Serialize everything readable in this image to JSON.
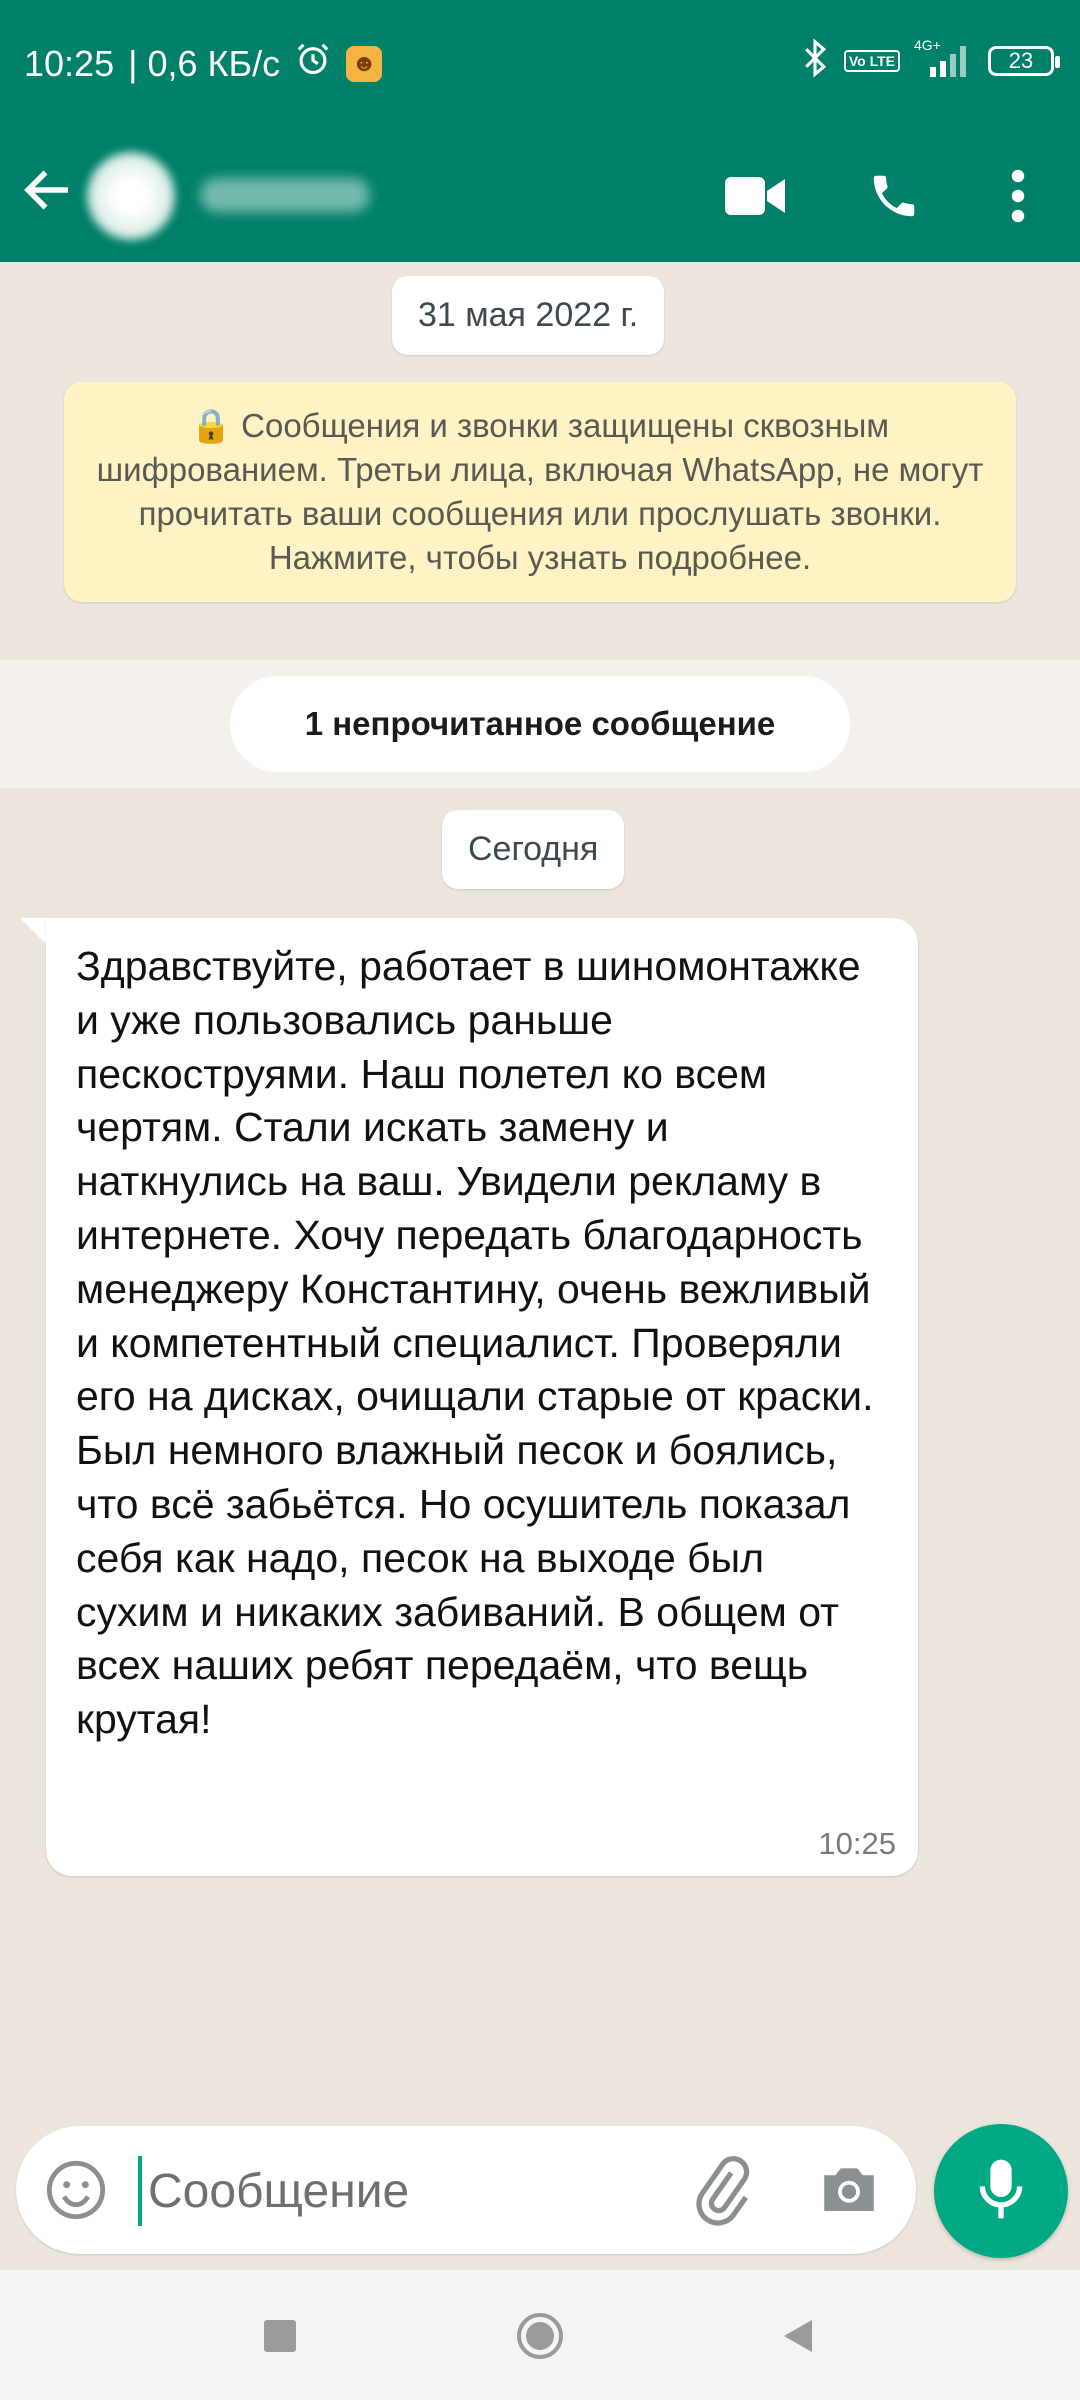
{
  "status_bar": {
    "time": "10:25",
    "speed": "| 0,6 КБ/с",
    "network": "4G+",
    "volte": "Vo LTE",
    "battery": "23",
    "icons": [
      "alarm-icon",
      "app-notification-icon",
      "bluetooth-icon",
      "volte-icon",
      "signal-icon",
      "battery-icon"
    ]
  },
  "app_bar": {
    "icons": [
      "back-arrow-icon",
      "video-call-icon",
      "phone-call-icon",
      "more-vert-icon"
    ]
  },
  "chat": {
    "date_chip": "31 мая 2022 г.",
    "encryption_notice": "🔒 Сообщения и звонки защищены сквозным шифрованием. Третьи лица, включая WhatsApp, не могут прочитать ваши сообщения или прослушать звонки. Нажмите, чтобы узнать подробнее.",
    "unread_label": "1 непрочитанное сообщение",
    "today_chip": "Сегодня",
    "message": {
      "text": "Здравствуйте, работает в шиномонтажке и уже пользовались раньше пескоструями. Наш полетел ко всем чертям. Стали искать замену и наткнулись на ваш. Увидели рекламу в интернете. Хочу передать благодарность менеджеру Константину, очень вежливый и компетентный специалист. Проверяли его на дисках, очищали старые от краски. Был немного влажный песок и боялись, что всё забьётся. Но осушитель показал себя как надо, песок на выходе был сухим и никаких забиваний. В общем от всех наших ребят передаём, что вещь крутая!",
      "time": "10:25"
    }
  },
  "composer": {
    "placeholder": "Сообщение",
    "icons": [
      "emoji-icon",
      "attach-icon",
      "camera-icon",
      "mic-icon"
    ]
  },
  "colors": {
    "header": "#008069",
    "accent": "#00a884",
    "chat_bg": "#ece5dd",
    "notice_bg": "#fdf3c5"
  }
}
